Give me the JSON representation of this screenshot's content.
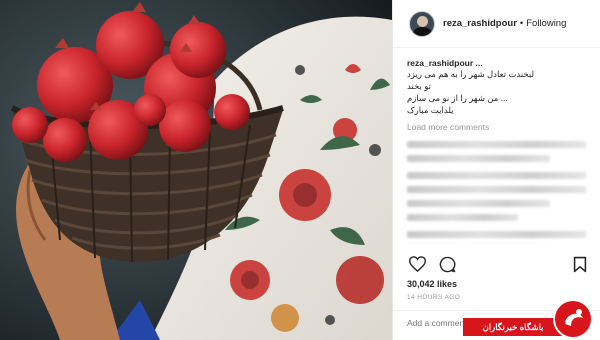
{
  "post": {
    "username": "reza_rashidpour",
    "follow_dot": "•",
    "follow_label": "Following"
  },
  "caption": {
    "username": "reza_rashidpour ...",
    "lines": [
      "لبخندت تعادل شهر را به هم می ریزد",
      "تو بخند",
      "... من شهر را از نو می سازم",
      "یلدایت مبارک"
    ]
  },
  "comments": {
    "load_more": "Load more comments"
  },
  "actions": {
    "like_icon": "heart-icon",
    "comment_icon": "comment-icon",
    "save_icon": "bookmark-icon"
  },
  "likes": "30,042 likes",
  "timestamp": "14 HOURS AGO",
  "add_comment_placeholder": "Add a comment...",
  "watermark": {
    "text": "باشگاه خبرنگاران",
    "color": "#d8151a"
  }
}
